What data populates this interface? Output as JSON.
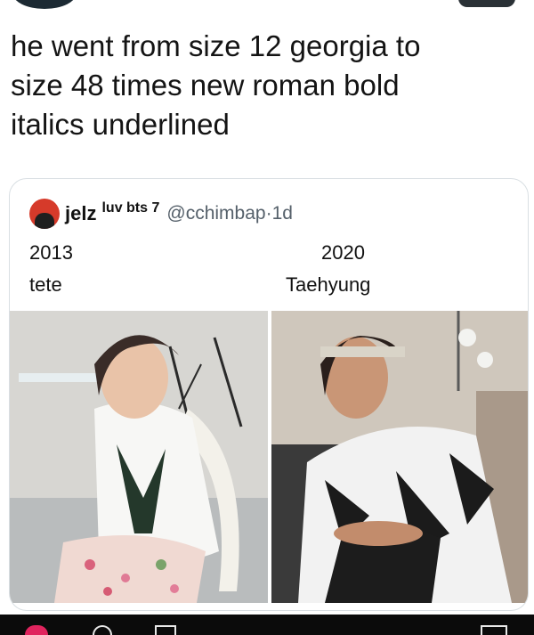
{
  "tweet": {
    "text": "he went from size 12 georgia to\nsize 48 times new roman bold\nitalics underlined"
  },
  "quote": {
    "name": "jelz",
    "name_suffix": "luv bts 7",
    "handle": "@cchimbap",
    "separator": " · ",
    "time": "1d",
    "left_year": "2013",
    "left_name": "tete",
    "right_year": "2020",
    "right_name": "Taehyung"
  },
  "colors": {
    "heart": "#e0245e",
    "handle": "#55606a",
    "card_border": "#d9dfe3"
  },
  "icons": [
    "heart-icon",
    "comment-icon",
    "retweet-icon",
    "share-icon"
  ]
}
